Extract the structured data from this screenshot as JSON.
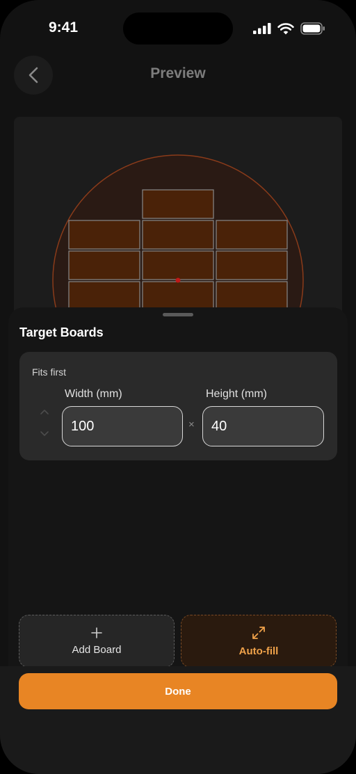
{
  "status": {
    "time": "9:41"
  },
  "nav": {
    "title": "Preview"
  },
  "preview": {
    "colors": {
      "circle_fill": "#2a1a14",
      "circle_stroke": "#8a3b1a",
      "board_fill": "#4a2208",
      "board_stroke": "#888888",
      "center_dot": "#c01818"
    }
  },
  "sheet": {
    "title": "Target Boards",
    "board": {
      "label": "Fits first",
      "width_label": "Width (mm)",
      "height_label": "Height (mm)",
      "width_value": "100",
      "height_value": "40",
      "separator": "×"
    },
    "add_label": "Add Board",
    "autofill_label": "Auto-fill"
  },
  "done_label": "Done",
  "accent": "#e88524"
}
